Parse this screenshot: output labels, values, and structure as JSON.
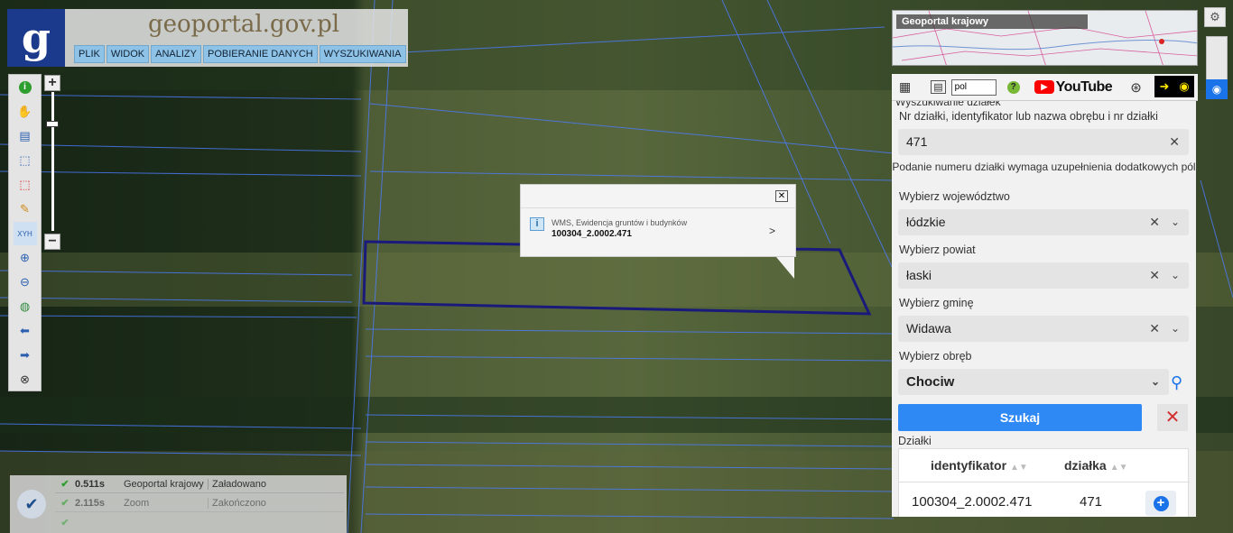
{
  "header": {
    "logo_letter": "g",
    "site_title": "geoportal.gov.pl",
    "menu": [
      "PLIK",
      "WIDOK",
      "ANALIZY",
      "POBIERANIE DANYCH",
      "WYSZUKIWANIA"
    ]
  },
  "toolbar": {
    "icons": [
      "info-icon",
      "pan-hand-icon",
      "legend-icon",
      "select-rectangle-icon",
      "select-red-icon",
      "pencil-icon",
      "xyh-icon",
      "zoom-in-icon",
      "zoom-out-icon",
      "globe-icon",
      "back-arrow-icon",
      "forward-arrow-icon",
      "compass-icon"
    ],
    "xyh_label": "XYH",
    "zoom_plus": "+",
    "zoom_minus": "−"
  },
  "popup": {
    "layer": "WMS, Ewidencja gruntów i budynków",
    "value": "100304_2.0002.471",
    "info_glyph": "i",
    "close_glyph": "✕",
    "arrow_glyph": ">"
  },
  "status": {
    "check_glyph": "✔",
    "rows": [
      {
        "time": "0.511s",
        "name": "Geoportal krajowy",
        "state": "Załadowano"
      },
      {
        "time": "2.115s",
        "name": "Zoom",
        "state": "Zakończono"
      },
      {
        "time": "",
        "name": "",
        "state": ""
      }
    ]
  },
  "minimap": {
    "title": "Geoportal krajowy"
  },
  "panel_top": {
    "language": "pol",
    "youtube_label": "YouTube",
    "help_glyph": "?"
  },
  "search_panel": {
    "title": "Wyszukiwanie działek",
    "parcel_label": "Nr działki, identyfikator lub nazwa obrębu i nr działki",
    "parcel_value": "471",
    "note": "Podanie numeru działki wymaga uzupełnienia dodatkowych pól",
    "voivodeship_label": "Wybierz województwo",
    "voivodeship_value": "łódzkie",
    "county_label": "Wybierz powiat",
    "county_value": "łaski",
    "commune_label": "Wybierz gminę",
    "commune_value": "Widawa",
    "precinct_label": "Wybierz obręb",
    "precinct_value": "Chociw",
    "search_button": "Szukaj",
    "results_label": "Działki",
    "columns": [
      "identyfikator",
      "działka"
    ],
    "rows": [
      {
        "identyfikator": "100304_2.0002.471",
        "dzialka": "471"
      }
    ]
  },
  "colors": {
    "parcel_outline": "#1a1a7a",
    "field_lines": "#4d7cff",
    "accent": "#2f89f5",
    "logo_bg": "#1b3a8c"
  }
}
